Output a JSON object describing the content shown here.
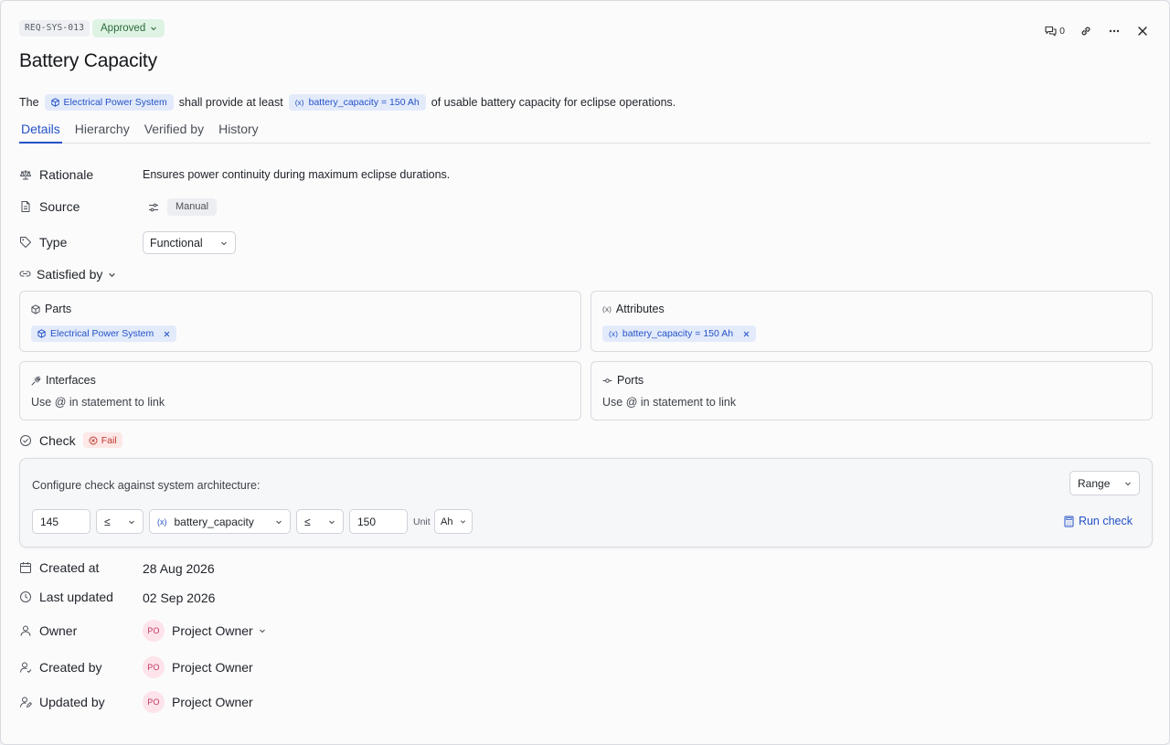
{
  "header": {
    "req_id": "REQ-SYS-013",
    "status": "Approved",
    "comment_count": "0",
    "title": "Battery Capacity"
  },
  "statement": {
    "prefix": "The",
    "part_chip": "Electrical Power System",
    "middle": "shall provide at least",
    "attr_chip": "battery_capacity = 150 Ah",
    "suffix": "of usable battery capacity for eclipse operations."
  },
  "tabs": [
    {
      "label": "Details",
      "active": true
    },
    {
      "label": "Hierarchy",
      "active": false
    },
    {
      "label": "Verified by",
      "active": false
    },
    {
      "label": "History",
      "active": false
    }
  ],
  "fields": {
    "rationale_label": "Rationale",
    "rationale_value": "Ensures power continuity during maximum eclipse durations.",
    "source_label": "Source",
    "source_value": "Manual",
    "type_label": "Type",
    "type_value": "Functional",
    "satisfied_by_label": "Satisfied by"
  },
  "satisfied_by": {
    "parts": {
      "label": "Parts",
      "chip": "Electrical Power System"
    },
    "attributes": {
      "label": "Attributes",
      "chip": "battery_capacity = 150 Ah"
    },
    "interfaces": {
      "label": "Interfaces",
      "empty": "Use @ in statement to link"
    },
    "ports": {
      "label": "Ports",
      "empty": "Use @ in statement to link"
    }
  },
  "check": {
    "label": "Check",
    "result": "Fail",
    "config_text": "Configure check against system architecture:",
    "mode": "Range",
    "min_value": "145",
    "op_left": "≤",
    "attribute": "battery_capacity",
    "op_right": "≤",
    "max_value": "150",
    "unit_label": "Unit",
    "unit": "Ah",
    "run_label": "Run check"
  },
  "meta": {
    "created_at_label": "Created at",
    "created_at": "28 Aug 2026",
    "last_updated_label": "Last updated",
    "last_updated": "02 Sep 2026",
    "owner_label": "Owner",
    "created_by_label": "Created by",
    "updated_by_label": "Updated by",
    "owner": {
      "initials": "PO",
      "name": "Project Owner"
    },
    "created_by": {
      "initials": "PO",
      "name": "Project Owner"
    },
    "updated_by": {
      "initials": "PO",
      "name": "Project Owner"
    }
  }
}
